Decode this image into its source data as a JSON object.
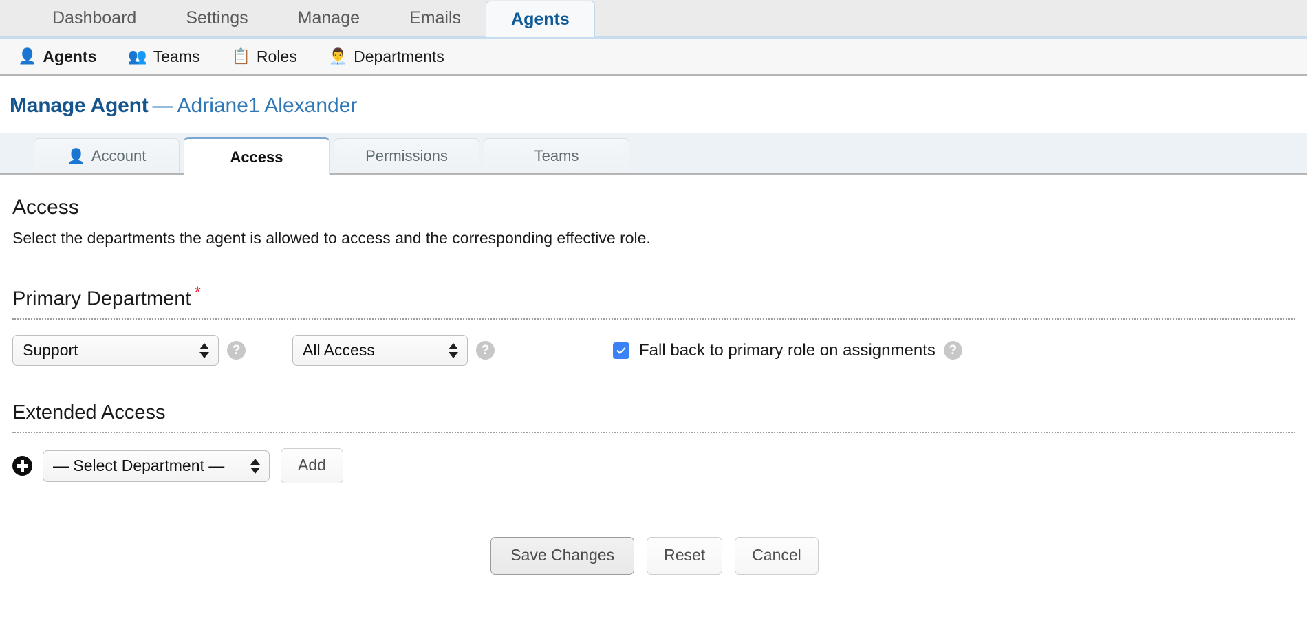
{
  "topnav": {
    "tabs": [
      {
        "label": "Dashboard",
        "active": false
      },
      {
        "label": "Settings",
        "active": false
      },
      {
        "label": "Manage",
        "active": false
      },
      {
        "label": "Emails",
        "active": false
      },
      {
        "label": "Agents",
        "active": true
      }
    ]
  },
  "subnav": {
    "items": [
      {
        "label": "Agents",
        "icon": "agent-person-icon",
        "glyph": "👤",
        "active": true
      },
      {
        "label": "Teams",
        "icon": "teams-people-icon",
        "glyph": "👥",
        "active": false
      },
      {
        "label": "Roles",
        "icon": "roles-list-icon",
        "glyph": "📋",
        "active": false
      },
      {
        "label": "Departments",
        "icon": "departments-desk-icon",
        "glyph": "👨‍💼",
        "active": false
      }
    ]
  },
  "page": {
    "title": "Manage Agent",
    "separator": "—",
    "agent_name": "Adriane1 Alexander"
  },
  "form_tabs": [
    {
      "label": "Account",
      "icon": "account-person-icon",
      "active": false
    },
    {
      "label": "Access",
      "icon": "",
      "active": true
    },
    {
      "label": "Permissions",
      "icon": "",
      "active": false
    },
    {
      "label": "Teams",
      "icon": "",
      "active": false
    }
  ],
  "access": {
    "heading": "Access",
    "description": "Select the departments the agent is allowed to access and the corresponding effective role.",
    "primary_department": {
      "heading": "Primary Department",
      "required_marker": "*",
      "department_value": "Support",
      "department_help": "?",
      "role_value": "All Access",
      "role_help": "?",
      "fallback_label": "Fall back to primary role on assignments",
      "fallback_checked": true,
      "fallback_help": "?"
    },
    "extended_access": {
      "heading": "Extended Access",
      "select_value": "— Select Department —",
      "add_label": "Add",
      "plus_icon": "add-circle-icon"
    }
  },
  "actions": {
    "save_label": "Save Changes",
    "reset_label": "Reset",
    "cancel_label": "Cancel"
  },
  "colors": {
    "brand_blue": "#15558d",
    "link_blue": "#2f77b5",
    "required_red": "#e8243c",
    "checkbox_blue": "#3b82f6",
    "active_tab_border": "#7ba7d0"
  }
}
